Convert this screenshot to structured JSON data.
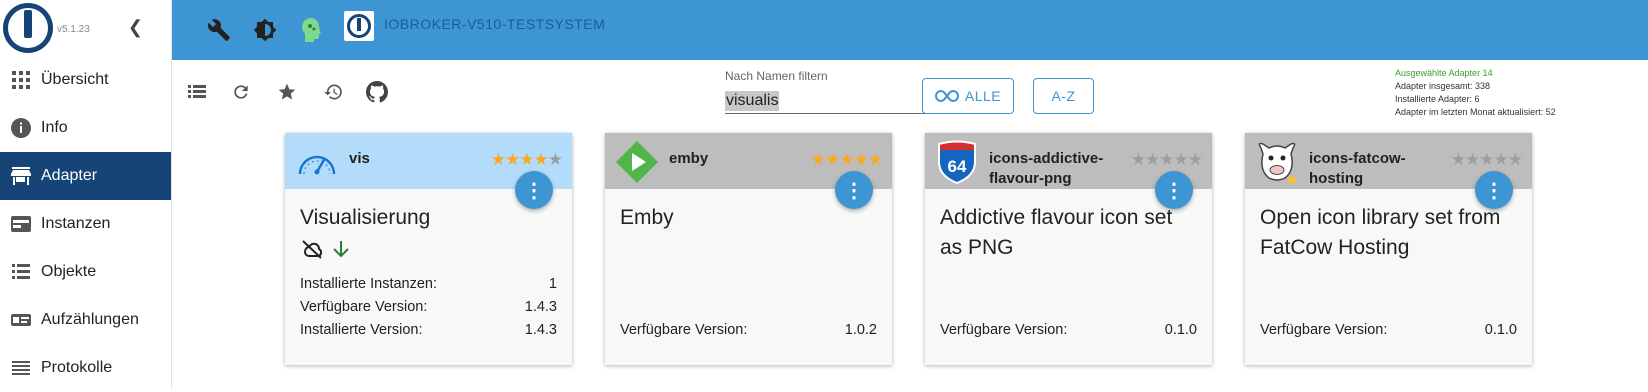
{
  "app": {
    "version": "v5.1.23",
    "system_title": "IOBROKER-V510-TESTSYSTEM"
  },
  "sidebar": {
    "items": [
      {
        "label": "Übersicht",
        "icon": "grid-icon"
      },
      {
        "label": "Info",
        "icon": "info-icon"
      },
      {
        "label": "Adapter",
        "icon": "store-icon",
        "active": true
      },
      {
        "label": "Instanzen",
        "icon": "instances-icon"
      },
      {
        "label": "Objekte",
        "icon": "list-icon"
      },
      {
        "label": "Aufzählungen",
        "icon": "enum-icon"
      },
      {
        "label": "Protokolle",
        "icon": "logs-icon"
      }
    ]
  },
  "toolbar": {
    "filter_label": "Nach Namen filtern",
    "filter_value": "visualis",
    "btn_all": "ALLE",
    "btn_az": "A-Z"
  },
  "stats": {
    "selected": "Ausgewählte Adapter 14",
    "total": "Adapter insgesamt: 338",
    "installed": "Installierte Adapter: 6",
    "updated": "Adapter im letzten Monat aktualisiert: 52"
  },
  "colors": {
    "topbar": "#3d95d3",
    "sidebar_active": "#164477",
    "card_selected": "#b3dcfb",
    "star": "#f9a825",
    "stats_green": "#3aa12b"
  },
  "cards": [
    {
      "name": "vis",
      "title": "Visualisierung",
      "rating": 4,
      "rows": [
        {
          "label": "Installierte Instanzen:",
          "value": "1"
        },
        {
          "label": "Verfügbare Version:",
          "value": "1.4.3"
        },
        {
          "label": "Installierte Version:",
          "value": "1.4.3"
        }
      ]
    },
    {
      "name": "emby",
      "title": "Emby",
      "rating": 5,
      "rows": [
        {
          "label": "Verfügbare Version:",
          "value": "1.0.2"
        }
      ]
    },
    {
      "name": "icons-addictive-flavour-png",
      "title": "Addictive flavour icon set as PNG",
      "rating": 0,
      "rows": [
        {
          "label": "Verfügbare Version:",
          "value": "0.1.0"
        }
      ]
    },
    {
      "name": "icons-fatcow-hosting",
      "title": "Open icon library set from FatCow Hosting",
      "rating": 0,
      "rows": [
        {
          "label": "Verfügbare Version:",
          "value": "0.1.0"
        }
      ]
    }
  ],
  "badges": {
    "interstate": "64"
  }
}
